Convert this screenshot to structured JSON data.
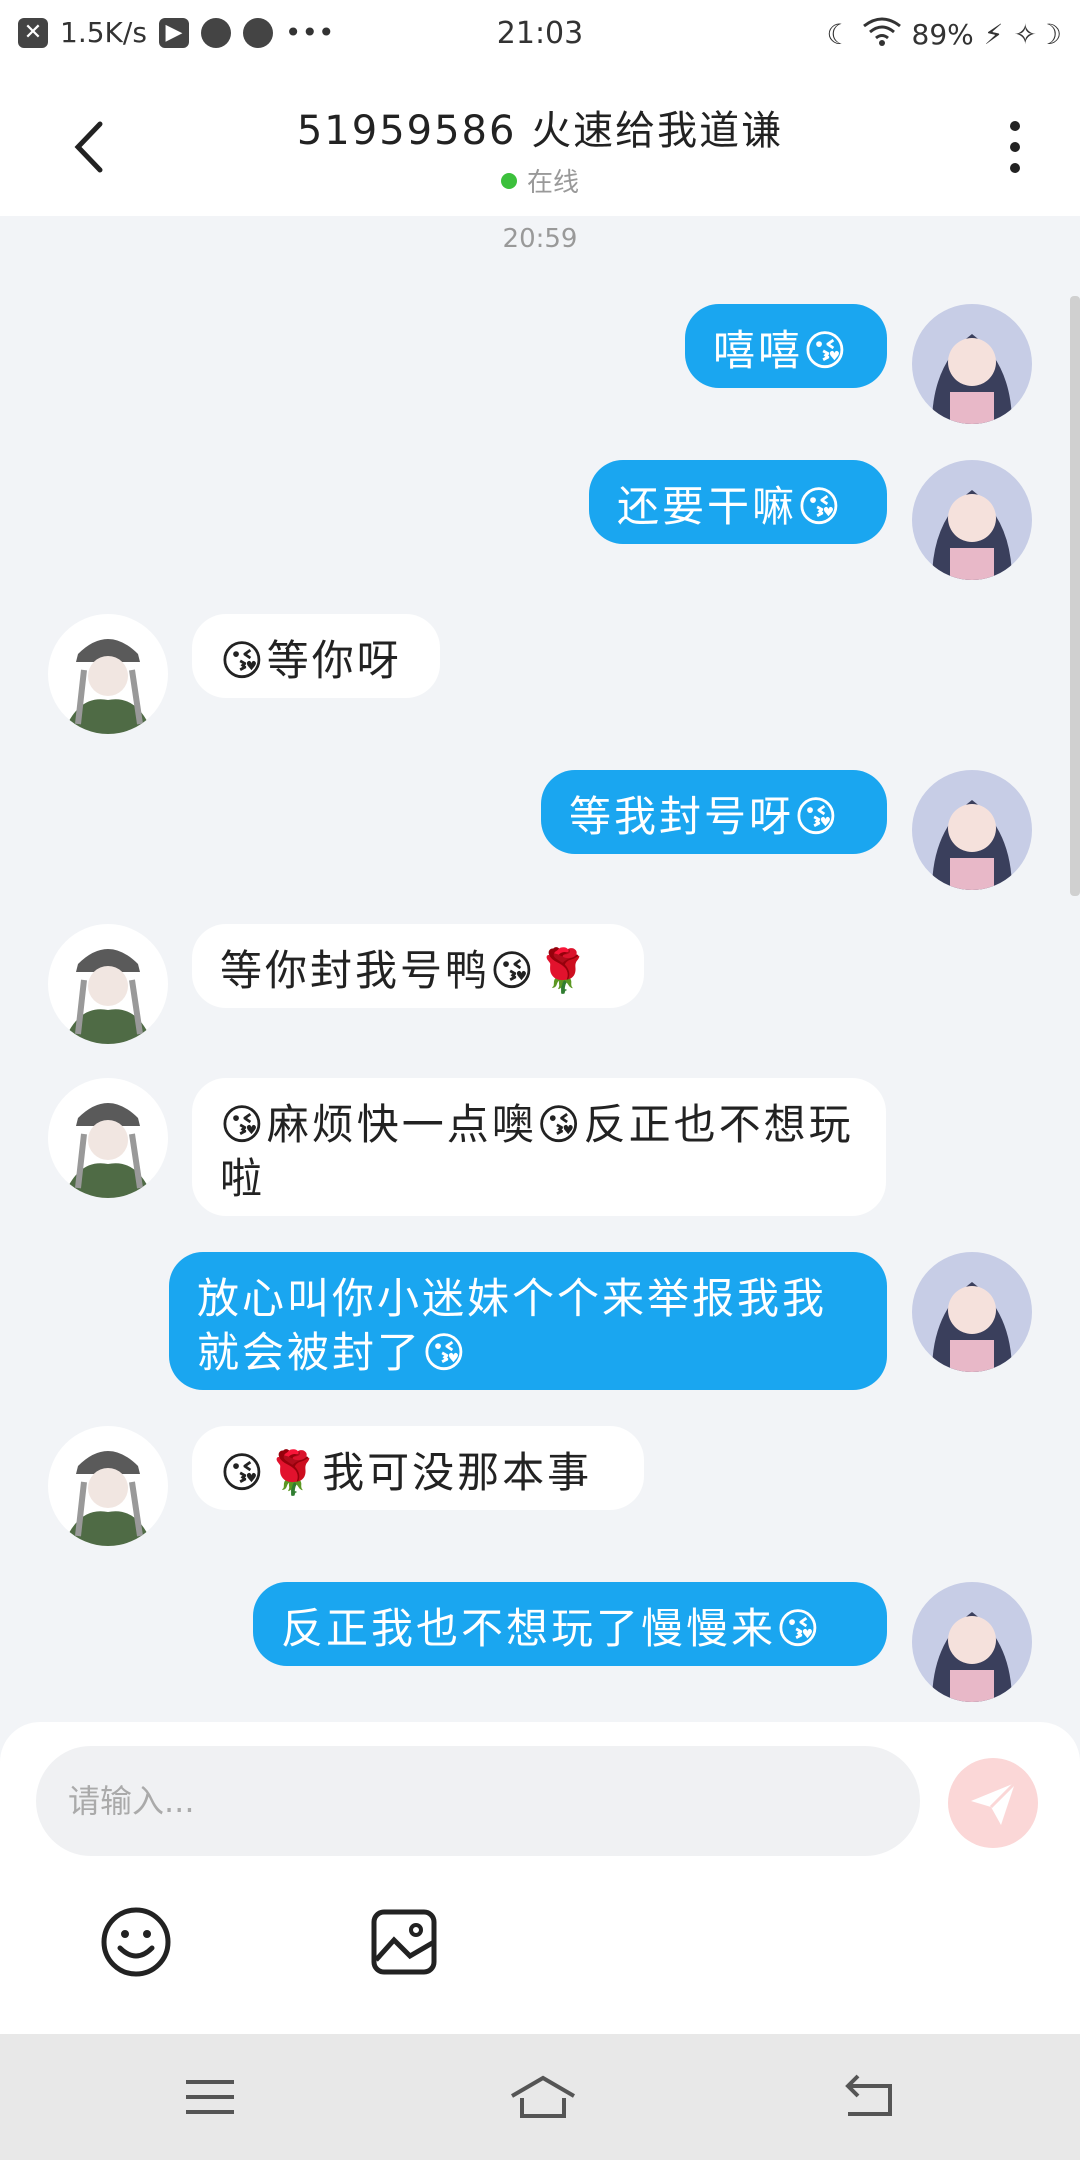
{
  "status_bar": {
    "speed": "1.5K/s",
    "time": "21:03",
    "battery": "89%"
  },
  "header": {
    "title": "51959586 火速给我道谦",
    "status": "在线"
  },
  "chat": {
    "timestamp": "20:59",
    "messages": [
      {
        "from": "me",
        "text": "嘻嘻😘"
      },
      {
        "from": "me",
        "text": "还要干嘛😘"
      },
      {
        "from": "other",
        "text": "😘等你呀"
      },
      {
        "from": "me",
        "text": "等我封号呀😘"
      },
      {
        "from": "other",
        "text": "等你封我号鸭😘🌹"
      },
      {
        "from": "other",
        "text": "😘麻烦快一点噢😘反正也不想玩啦"
      },
      {
        "from": "me",
        "text": "放心叫你小迷妹个个来举报我我就会被封了😘"
      },
      {
        "from": "other",
        "text": "😘🌹我可没那本事"
      },
      {
        "from": "me",
        "text": "反正我也不想玩了慢慢来😘"
      }
    ]
  },
  "input": {
    "placeholder": "请输入..."
  },
  "colors": {
    "me_bubble": "#1aa6f0",
    "other_bubble": "#ffffff",
    "online_dot": "#3cc03c"
  }
}
